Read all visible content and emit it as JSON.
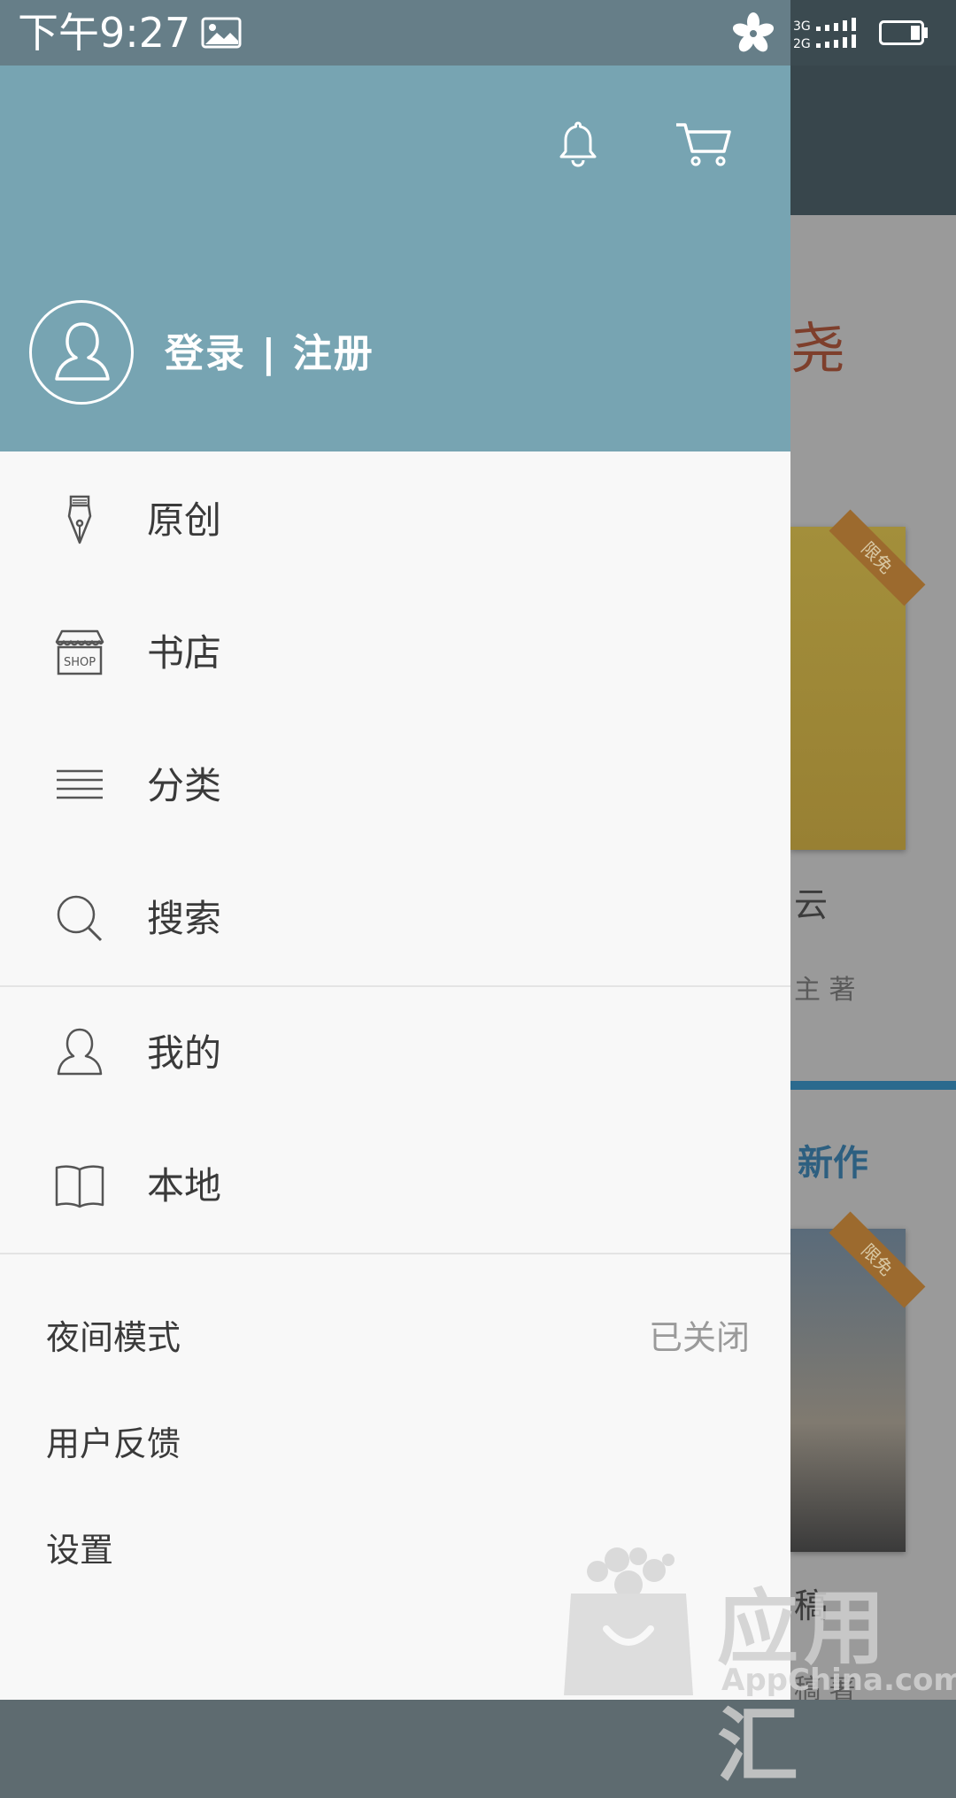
{
  "status_bar": {
    "time": "下午9:27",
    "network_top": "3G",
    "network_bottom": "2G"
  },
  "drawer": {
    "header": {
      "login_text": "登录 | 注册"
    },
    "menu": [
      {
        "label": "原创",
        "icon": "fountain-pen-icon"
      },
      {
        "label": "书店",
        "icon": "shop-icon",
        "icon_text": "SHOP"
      },
      {
        "label": "分类",
        "icon": "list-icon"
      },
      {
        "label": "搜索",
        "icon": "search-icon"
      },
      {
        "label": "我的",
        "icon": "user-icon"
      },
      {
        "label": "本地",
        "icon": "book-icon"
      }
    ],
    "settings": [
      {
        "label": "夜间模式",
        "value": "已关闭"
      },
      {
        "label": "用户反馈"
      },
      {
        "label": "设置"
      }
    ]
  },
  "background": {
    "heading_char": "尧",
    "cover1_badge": "限免",
    "cover1_title": "云",
    "cover1_author": "主 著",
    "section_heading": "新作",
    "cover2_badge": "限免",
    "cover2_title": "稿",
    "cover2_author": "稿 著"
  },
  "watermark": {
    "text": "应用汇",
    "sub": "AppChina.com"
  },
  "colors": {
    "header": "#77a4b2",
    "statusbar": "#667e88",
    "drawer_bg": "#f8f8f8",
    "text": "#3a3a3a",
    "muted": "#9a9a9a"
  }
}
